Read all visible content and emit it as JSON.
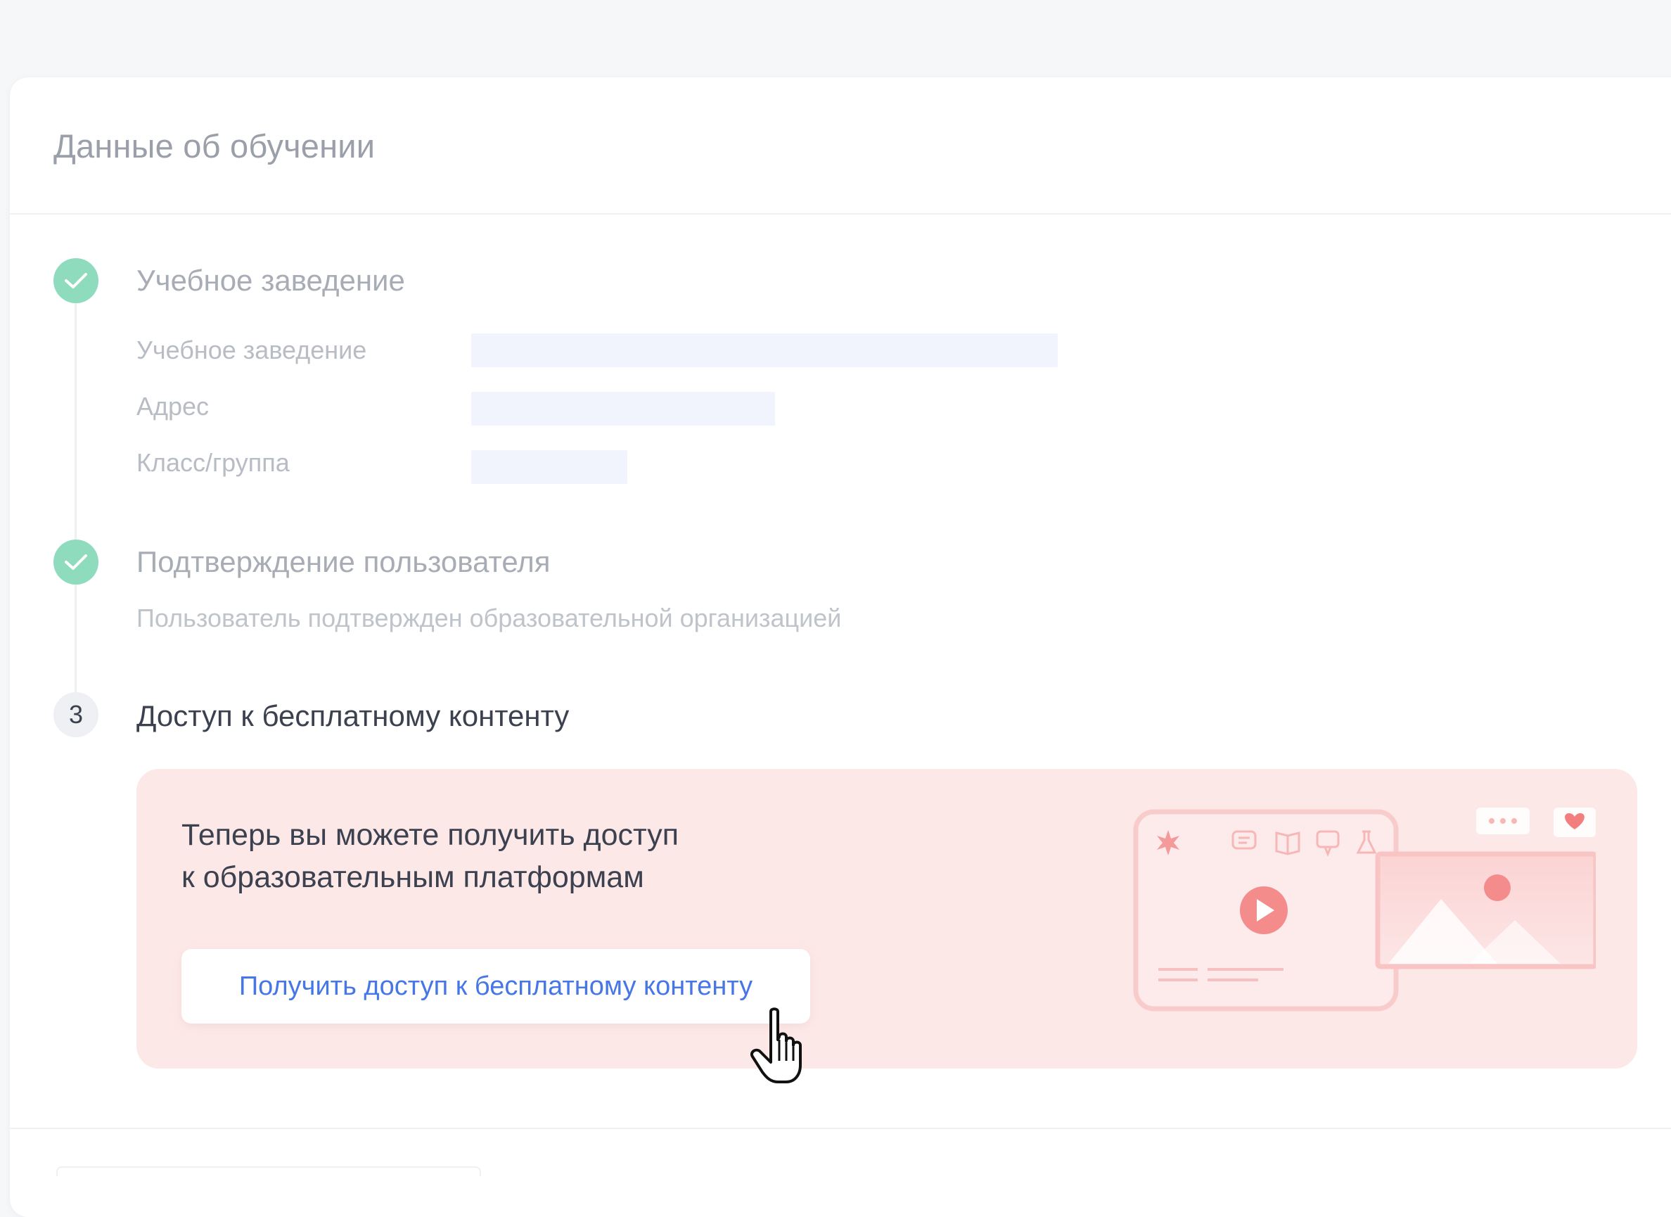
{
  "card": {
    "title": "Данные об обучении"
  },
  "steps": [
    {
      "status": "done",
      "title": "Учебное заведение",
      "fields": [
        {
          "label": "Учебное заведение"
        },
        {
          "label": "Адрес"
        },
        {
          "label": "Класс/группа"
        }
      ]
    },
    {
      "status": "done",
      "title": "Подтверждение пользователя",
      "description": "Пользователь подтвержден образовательной организацией"
    },
    {
      "status": "active",
      "number": "3",
      "title": "Доступ к бесплатному контенту"
    }
  ],
  "promo": {
    "text_line1": "Теперь вы можете получить доступ",
    "text_line2": "к образовательным платформам",
    "button_label": "Получить доступ к бесплатному контенту"
  },
  "colors": {
    "page_bg": "#f6f7f9",
    "done_check": "#8edcbd",
    "promo_bg": "#fde8e8",
    "link_blue": "#4776e6",
    "accent_red": "#f07f7f"
  },
  "icons": [
    "check-icon",
    "pointer-cursor-icon",
    "play-icon",
    "chat-icon",
    "book-icon",
    "flask-icon",
    "star-icon",
    "heart-icon",
    "dots-icon",
    "image-icon"
  ]
}
